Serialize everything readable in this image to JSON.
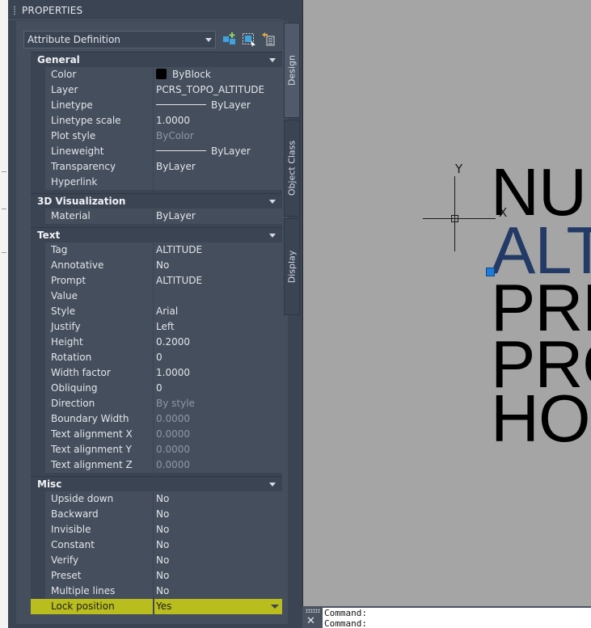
{
  "palette": {
    "title": "PROPERTIES",
    "object_type": "Attribute Definition",
    "toolbar": [
      {
        "icon": "toggle-pickadd-icon"
      },
      {
        "icon": "select-objects-icon"
      },
      {
        "icon": "quick-select-icon"
      }
    ],
    "tabs": [
      "Design",
      "Object Class",
      "Display"
    ],
    "categories": {
      "general": {
        "label": "General",
        "rows": {
          "color": {
            "name": "Color",
            "value": "ByBlock"
          },
          "layer": {
            "name": "Layer",
            "value": "PCRS_TOPO_ALTITUDE"
          },
          "linetype": {
            "name": "Linetype",
            "value": "ByLayer"
          },
          "linetype_scale": {
            "name": "Linetype scale",
            "value": "1.0000"
          },
          "plot_style": {
            "name": "Plot style",
            "value": "ByColor"
          },
          "lineweight": {
            "name": "Lineweight",
            "value": "ByLayer"
          },
          "transparency": {
            "name": "Transparency",
            "value": "ByLayer"
          },
          "hyperlink": {
            "name": "Hyperlink",
            "value": ""
          }
        }
      },
      "viz3d": {
        "label": "3D Visualization",
        "rows": {
          "material": {
            "name": "Material",
            "value": "ByLayer"
          }
        }
      },
      "text": {
        "label": "Text",
        "rows": {
          "tag": {
            "name": "Tag",
            "value": "ALTITUDE"
          },
          "annotative": {
            "name": "Annotative",
            "value": "No"
          },
          "prompt": {
            "name": "Prompt",
            "value": "ALTITUDE"
          },
          "value": {
            "name": "Value",
            "value": ""
          },
          "style": {
            "name": "Style",
            "value": "Arial"
          },
          "justify": {
            "name": "Justify",
            "value": "Left"
          },
          "height": {
            "name": "Height",
            "value": "0.2000"
          },
          "rotation": {
            "name": "Rotation",
            "value": "0"
          },
          "width_factor": {
            "name": "Width factor",
            "value": "1.0000"
          },
          "obliquing": {
            "name": "Obliquing",
            "value": "0"
          },
          "direction": {
            "name": "Direction",
            "value": "By style"
          },
          "boundary_width": {
            "name": "Boundary Width",
            "value": "0.0000"
          },
          "align_x": {
            "name": "Text alignment X",
            "value": "0.0000"
          },
          "align_y": {
            "name": "Text alignment Y",
            "value": "0.0000"
          },
          "align_z": {
            "name": "Text alignment Z",
            "value": "0.0000"
          }
        }
      },
      "misc": {
        "label": "Misc",
        "rows": {
          "upside_down": {
            "name": "Upside down",
            "value": "No"
          },
          "backward": {
            "name": "Backward",
            "value": "No"
          },
          "invisible": {
            "name": "Invisible",
            "value": "No"
          },
          "constant": {
            "name": "Constant",
            "value": "No"
          },
          "verify": {
            "name": "Verify",
            "value": "No"
          },
          "preset": {
            "name": "Preset",
            "value": "No"
          },
          "multiple_lines": {
            "name": "Multiple lines",
            "value": "No"
          },
          "lock_position": {
            "name": "Lock position",
            "value": "Yes"
          }
        }
      }
    }
  },
  "drawing": {
    "ucs_y": "Y",
    "ucs_x": "X",
    "attribute_text_lines": [
      "NUM",
      "ALT",
      "PRE",
      "PRO",
      "HOR"
    ]
  },
  "command_line": {
    "label": "Command:",
    "prior": "Command:"
  },
  "colors": {
    "palette_bg": "#454e5c",
    "header_bg": "#3b4453",
    "highlight": "#b9bd1e",
    "drawing_bg": "#a5a5a5",
    "selected_text": "#233a66",
    "grip": "#1f7bd6"
  }
}
